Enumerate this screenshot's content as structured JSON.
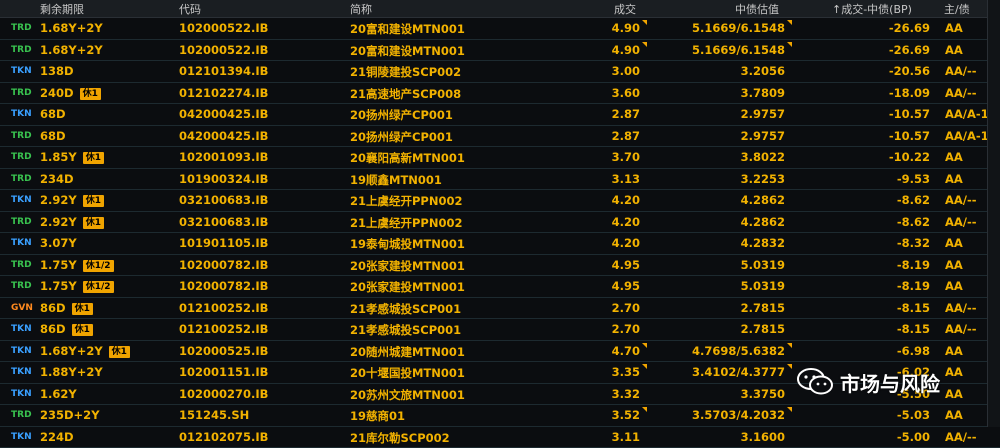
{
  "header": {
    "term": "剩余期限",
    "code": "代码",
    "name": "简称",
    "deal": "成交",
    "est": "中债估值",
    "spread": "↑成交-中债(BP)",
    "rating": "主/债"
  },
  "colors": {
    "text": "#f2b200",
    "TRD": "#39c24f",
    "TKN": "#3aa0ff",
    "GVN": "#ff8a1f",
    "badge": "#f0a400"
  },
  "rows": [
    {
      "type": "TRD",
      "term": "1.68Y+2Y",
      "badge": "",
      "code": "102000522.IB",
      "name": "20富和建设MTN001",
      "deal": "4.90",
      "est": "5.1669/6.1548",
      "spread": "-26.69",
      "rating": "AA"
    },
    {
      "type": "TRD",
      "term": "1.68Y+2Y",
      "badge": "",
      "code": "102000522.IB",
      "name": "20富和建设MTN001",
      "deal": "4.90",
      "est": "5.1669/6.1548",
      "spread": "-26.69",
      "rating": "AA"
    },
    {
      "type": "TKN",
      "term": "138D",
      "badge": "",
      "code": "012101394.IB",
      "name": "21铜陵建投SCP002",
      "deal": "3.00",
      "est": "3.2056",
      "spread": "-20.56",
      "rating": "AA/--"
    },
    {
      "type": "TRD",
      "term": "240D",
      "badge": "休1",
      "code": "012102274.IB",
      "name": "21高速地产SCP008",
      "deal": "3.60",
      "est": "3.7809",
      "spread": "-18.09",
      "rating": "AA/--"
    },
    {
      "type": "TKN",
      "term": "68D",
      "badge": "",
      "code": "042000425.IB",
      "name": "20扬州绿产CP001",
      "deal": "2.87",
      "est": "2.9757",
      "spread": "-10.57",
      "rating": "AA/A-1"
    },
    {
      "type": "TRD",
      "term": "68D",
      "badge": "",
      "code": "042000425.IB",
      "name": "20扬州绿产CP001",
      "deal": "2.87",
      "est": "2.9757",
      "spread": "-10.57",
      "rating": "AA/A-1"
    },
    {
      "type": "TRD",
      "term": "1.85Y",
      "badge": "休1",
      "code": "102001093.IB",
      "name": "20襄阳高新MTN001",
      "deal": "3.70",
      "est": "3.8022",
      "spread": "-10.22",
      "rating": "AA"
    },
    {
      "type": "TRD",
      "term": "234D",
      "badge": "",
      "code": "101900324.IB",
      "name": "19顺鑫MTN001",
      "deal": "3.13",
      "est": "3.2253",
      "spread": "-9.53",
      "rating": "AA"
    },
    {
      "type": "TKN",
      "term": "2.92Y",
      "badge": "休1",
      "code": "032100683.IB",
      "name": "21上虞经开PPN002",
      "deal": "4.20",
      "est": "4.2862",
      "spread": "-8.62",
      "rating": "AA/--"
    },
    {
      "type": "TRD",
      "term": "2.92Y",
      "badge": "休1",
      "code": "032100683.IB",
      "name": "21上虞经开PPN002",
      "deal": "4.20",
      "est": "4.2862",
      "spread": "-8.62",
      "rating": "AA/--"
    },
    {
      "type": "TKN",
      "term": "3.07Y",
      "badge": "",
      "code": "101901105.IB",
      "name": "19泰甸城投MTN001",
      "deal": "4.20",
      "est": "4.2832",
      "spread": "-8.32",
      "rating": "AA"
    },
    {
      "type": "TRD",
      "term": "1.75Y",
      "badge": "休1/2",
      "code": "102000782.IB",
      "name": "20张家建投MTN001",
      "deal": "4.95",
      "est": "5.0319",
      "spread": "-8.19",
      "rating": "AA"
    },
    {
      "type": "TRD",
      "term": "1.75Y",
      "badge": "休1/2",
      "code": "102000782.IB",
      "name": "20张家建投MTN001",
      "deal": "4.95",
      "est": "5.0319",
      "spread": "-8.19",
      "rating": "AA"
    },
    {
      "type": "GVN",
      "term": "86D",
      "badge": "休1",
      "code": "012100252.IB",
      "name": "21孝感城投SCP001",
      "deal": "2.70",
      "est": "2.7815",
      "spread": "-8.15",
      "rating": "AA/--"
    },
    {
      "type": "TKN",
      "term": "86D",
      "badge": "休1",
      "code": "012100252.IB",
      "name": "21孝感城投SCP001",
      "deal": "2.70",
      "est": "2.7815",
      "spread": "-8.15",
      "rating": "AA/--"
    },
    {
      "type": "TKN",
      "term": "1.68Y+2Y",
      "badge": "休1",
      "code": "102000525.IB",
      "name": "20随州城建MTN001",
      "deal": "4.70",
      "est": "4.7698/5.6382",
      "spread": "-6.98",
      "rating": "AA"
    },
    {
      "type": "TKN",
      "term": "1.88Y+2Y",
      "badge": "",
      "code": "102001151.IB",
      "name": "20十堰国投MTN001",
      "deal": "3.35",
      "est": "3.4102/4.3777",
      "spread": "-6.02",
      "rating": "AA"
    },
    {
      "type": "TKN",
      "term": "1.62Y",
      "badge": "",
      "code": "102000270.IB",
      "name": "20苏州文旅MTN001",
      "deal": "3.32",
      "est": "3.3750",
      "spread": "-5.50",
      "rating": "AA"
    },
    {
      "type": "TRD",
      "term": "235D+2Y",
      "badge": "",
      "code": "151245.SH",
      "name": "19慈商01",
      "deal": "3.52",
      "est": "3.5703/4.2032",
      "spread": "-5.03",
      "rating": "AA"
    },
    {
      "type": "TKN",
      "term": "224D",
      "badge": "",
      "code": "012102075.IB",
      "name": "21库尔勒SCP002",
      "deal": "3.11",
      "est": "3.1600",
      "spread": "-5.00",
      "rating": "AA/--"
    }
  ],
  "watermark": {
    "text": "市场与风险",
    "icon": "wechat-icon"
  }
}
